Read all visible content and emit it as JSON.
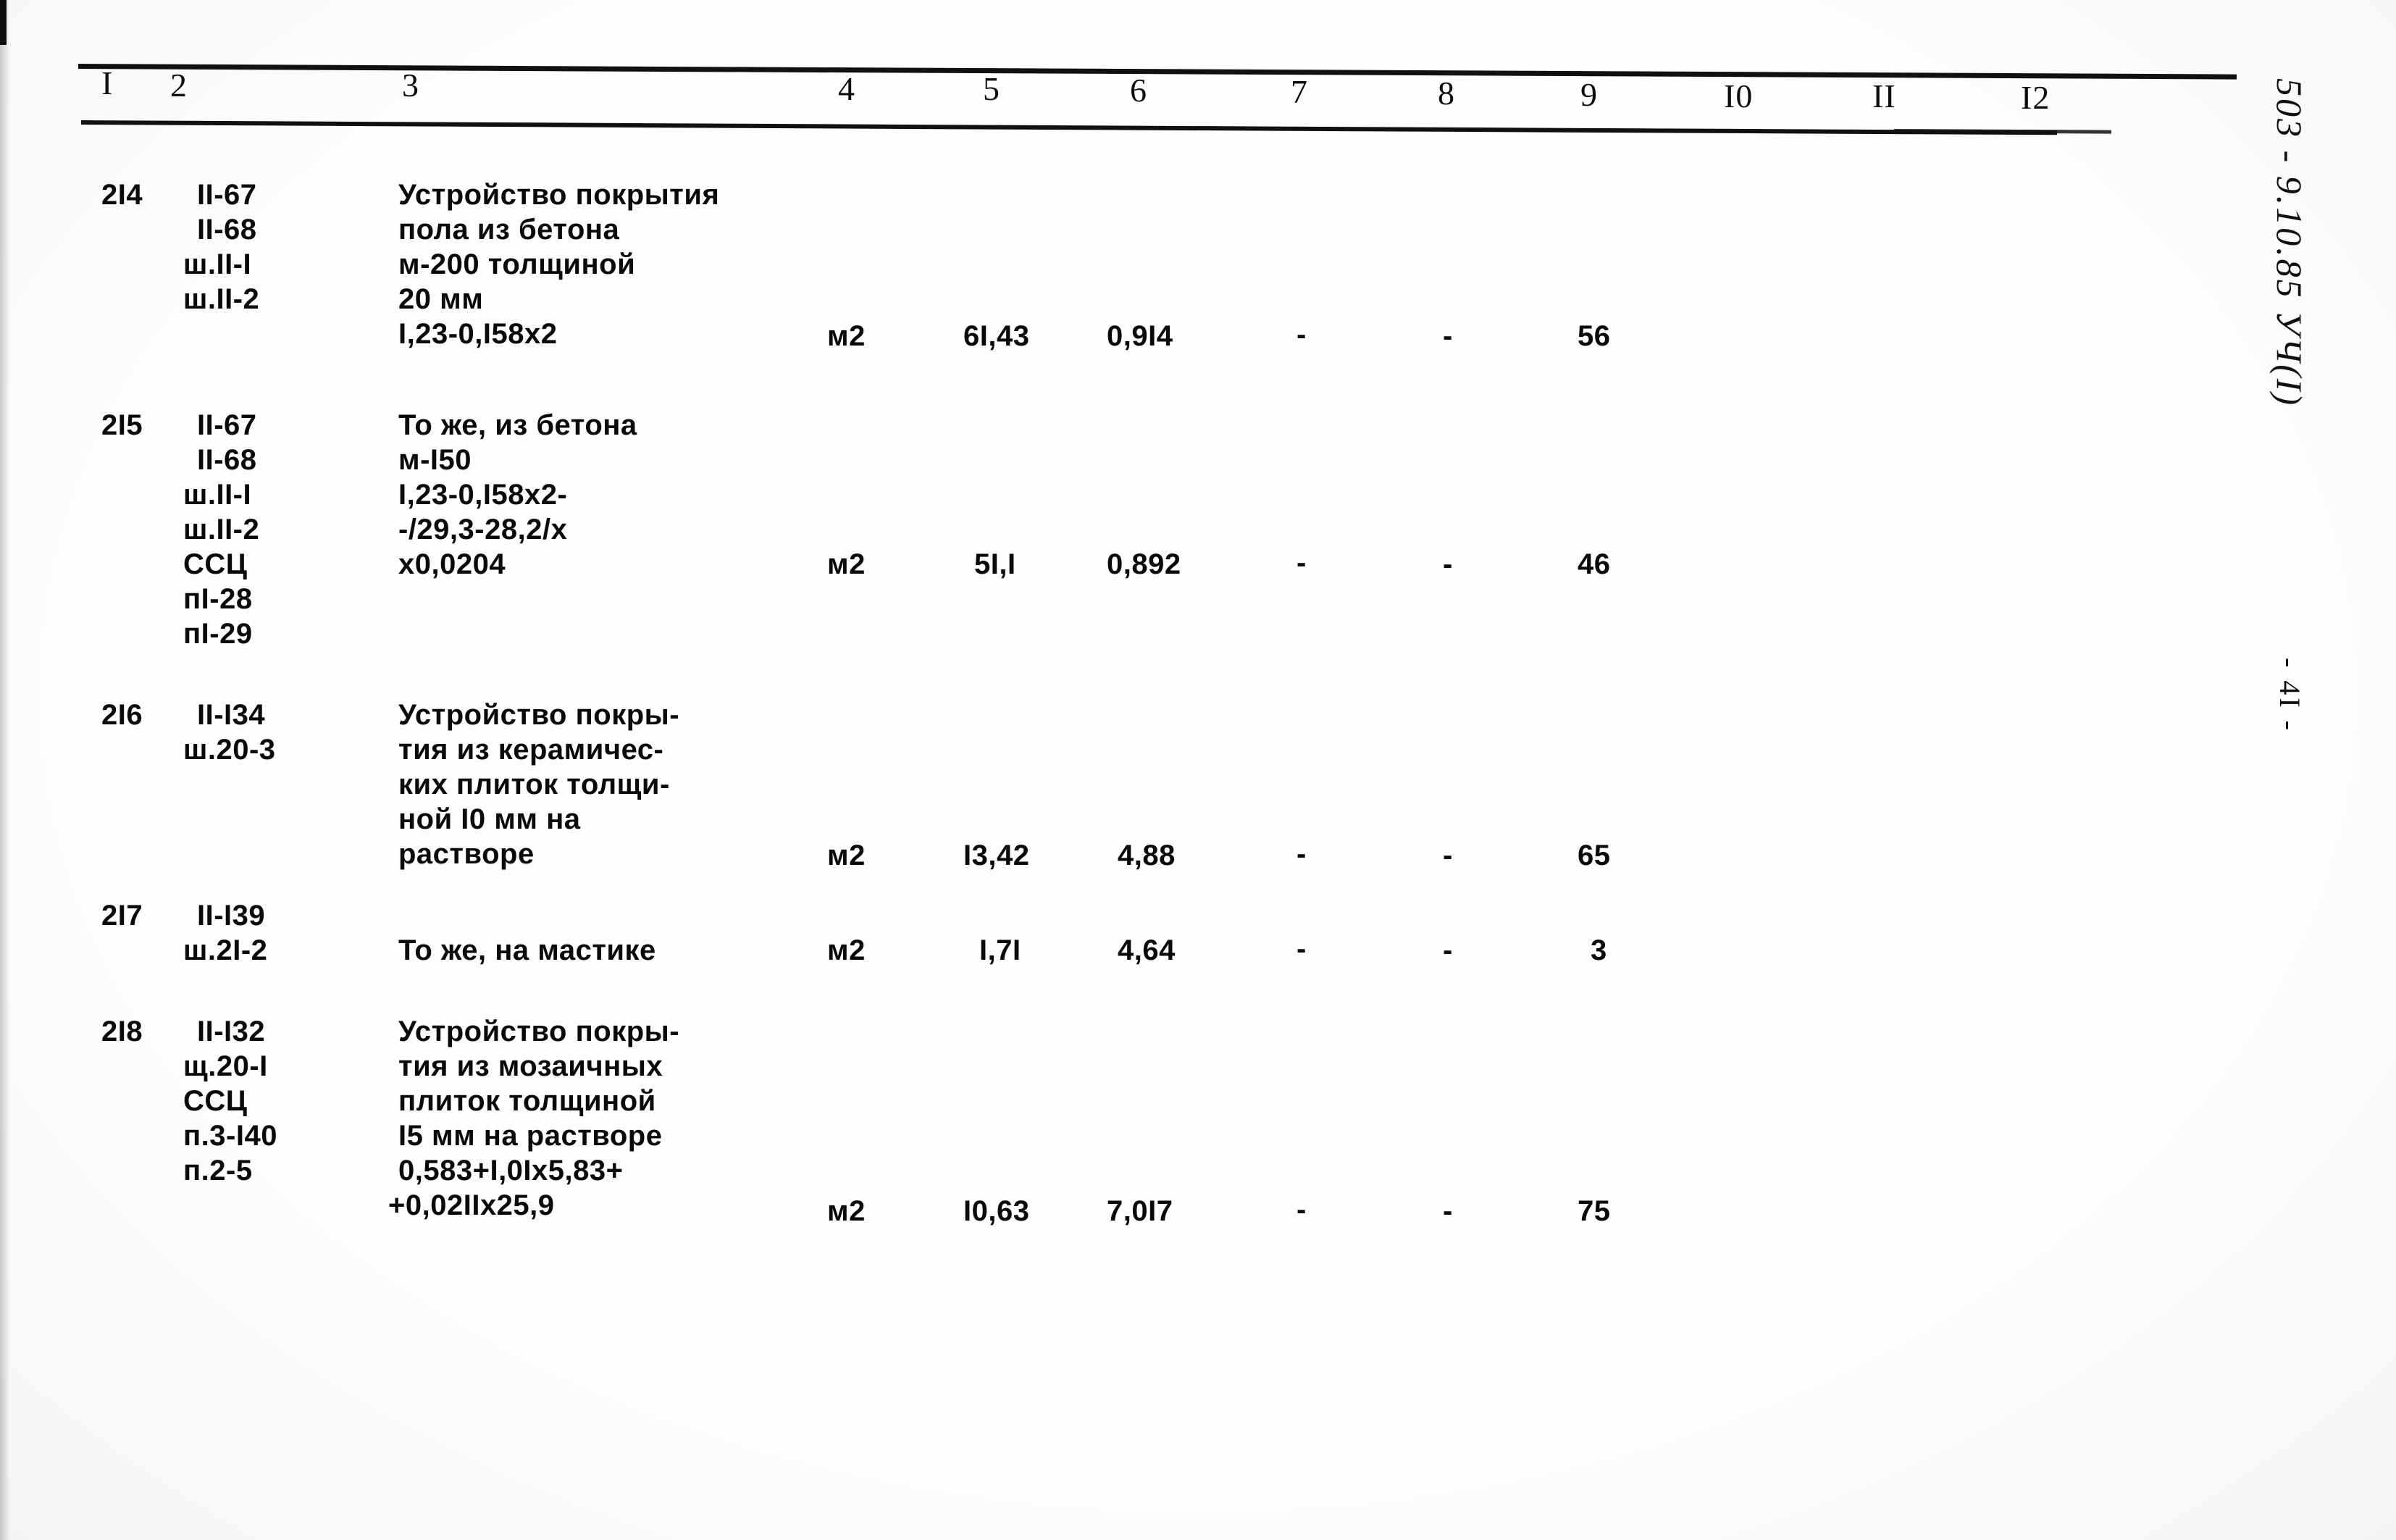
{
  "document": {
    "kind": "scanned-estimate-table",
    "page_label": "- 4I -",
    "sheet_code": "503 - 9.10.85 УЧ(I)"
  },
  "table": {
    "column_numbers": [
      "I",
      "2",
      "3",
      "4",
      "5",
      "6",
      "7",
      "8",
      "9",
      "I0",
      "II",
      "I2"
    ],
    "rows": [
      {
        "index": "2I4",
        "codes": [
          "II-67",
          "II-68",
          "ш.II-I",
          "ш.II-2"
        ],
        "description_lines": [
          "Устройство покрытия",
          "пола из бетона",
          "м-200 толщиной",
          "20 мм",
          "I,23-0,I58x2"
        ],
        "unit": "м2",
        "col5": "6I,43",
        "col6": "0,9I4",
        "col7": "-",
        "col8": "-",
        "col9": "56",
        "col10": "",
        "col11": "",
        "col12": ""
      },
      {
        "index": "2I5",
        "codes": [
          "II-67",
          "II-68",
          "ш.II-I",
          "ш.II-2",
          "ССЦ",
          "пI-28",
          "пI-29"
        ],
        "description_lines": [
          "То же, из бетона",
          "м-I50",
          "I,23-0,I58x2-",
          "-/29,3-28,2/x",
          "x0,0204"
        ],
        "unit": "м2",
        "col5": "5I,I",
        "col6": "0,892",
        "col7": "-",
        "col8": "-",
        "col9": "46",
        "col10": "",
        "col11": "",
        "col12": ""
      },
      {
        "index": "2I6",
        "codes": [
          "II-I34",
          "ш.20-3"
        ],
        "description_lines": [
          "Устройство покры-",
          "тия из керамичес-",
          "ких плиток толщи-",
          "ной I0 мм на",
          "растворе"
        ],
        "unit": "м2",
        "col5": "I3,42",
        "col6": "4,88",
        "col7": "-",
        "col8": "-",
        "col9": "65",
        "col10": "",
        "col11": "",
        "col12": ""
      },
      {
        "index": "2I7",
        "codes": [
          "II-I39",
          "ш.2I-2"
        ],
        "description_lines": [
          "То же, на мастике"
        ],
        "unit": "м2",
        "col5": "I,7I",
        "col6": "4,64",
        "col7": "-",
        "col8": "-",
        "col9": "3",
        "col10": "",
        "col11": "",
        "col12": ""
      },
      {
        "index": "2I8",
        "codes": [
          "II-I32",
          "щ.20-I",
          "ССЦ",
          "п.3-I40",
          "п.2-5"
        ],
        "description_lines": [
          "Устройство покры-",
          "тия из мозаичных",
          "плиток толщиной",
          "I5 мм на растворе",
          "0,583+I,0Ix5,83+",
          "+0,02IIx25,9"
        ],
        "unit": "м2",
        "col5": "I0,63",
        "col6": "7,0I7",
        "col7": "-",
        "col8": "-",
        "col9": "75",
        "col10": "",
        "col11": "",
        "col12": ""
      }
    ]
  }
}
